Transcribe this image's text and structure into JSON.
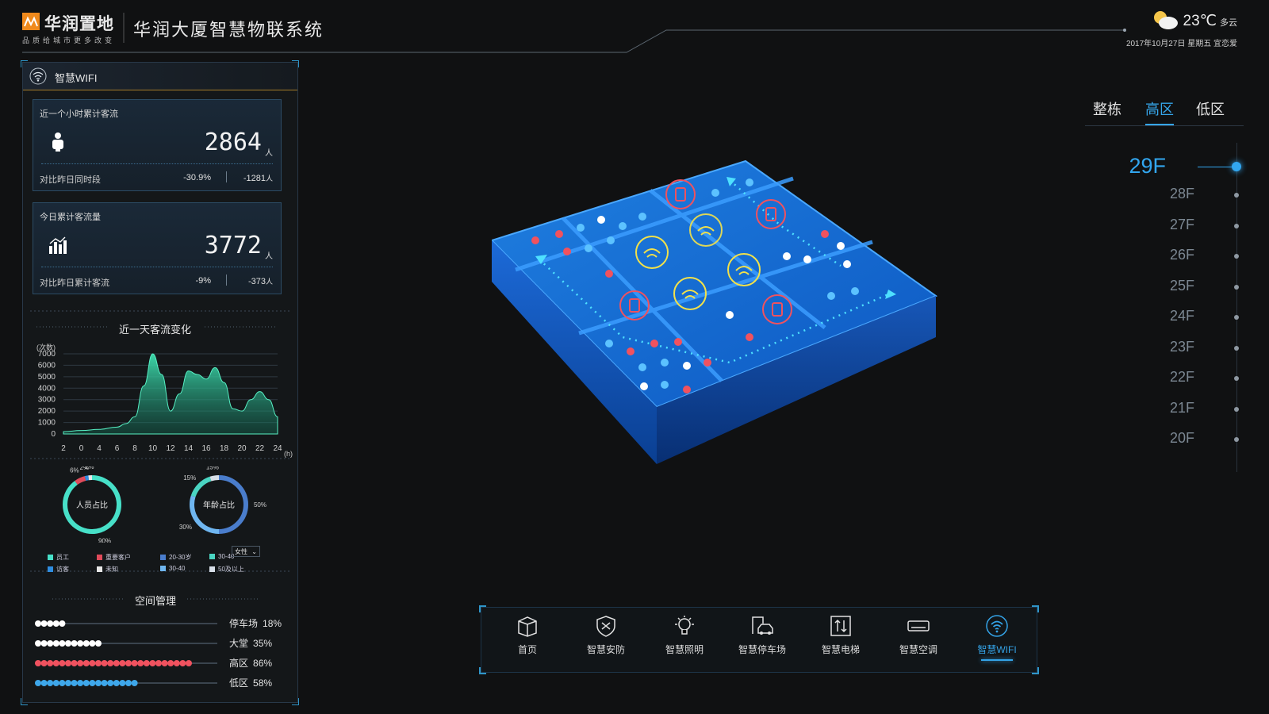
{
  "brand": {
    "name": "华润置地",
    "slogan": "品质给城市更多改变"
  },
  "system_title": "华润大厦智慧物联系统",
  "weather": {
    "temperature": "23℃",
    "condition": "多云",
    "date_line": "2017年10月27日 星期五 宜恋爱"
  },
  "panel": {
    "title": "智慧WIFI"
  },
  "card_hour": {
    "title": "近一个小时累计客流",
    "value": "2864",
    "unit": "人",
    "compare_label": "对比昨日同时段",
    "percent": "-30.9%",
    "delta": "-1281",
    "delta_unit": "人"
  },
  "card_day": {
    "title": "今日累计客流量",
    "value": "3772",
    "unit": "人",
    "compare_label": "对比昨日累计客流",
    "percent": "-9%",
    "delta": "-373",
    "delta_unit": "人"
  },
  "chart_data": {
    "type": "area",
    "title": "近一天客流变化",
    "ylabel": "(次数)",
    "xlabel": "(h)",
    "ylim": [
      0,
      7000
    ],
    "y_ticks": [
      "7000",
      "6000",
      "5000",
      "4000",
      "3000",
      "2000",
      "1000",
      "0"
    ],
    "x_ticks": [
      "2",
      "0",
      "4",
      "6",
      "8",
      "10",
      "12",
      "14",
      "16",
      "18",
      "20",
      "22",
      "24"
    ],
    "x": [
      0,
      2,
      4,
      6,
      7,
      8,
      9,
      10,
      11,
      12,
      13,
      14,
      15,
      16,
      17,
      18,
      19,
      20,
      21,
      22,
      23,
      24
    ],
    "values": [
      200,
      300,
      400,
      600,
      900,
      1500,
      4200,
      7000,
      5200,
      2000,
      3500,
      5500,
      5200,
      4800,
      5800,
      4500,
      2200,
      2000,
      3000,
      3700,
      3000,
      1500
    ],
    "grid": true,
    "color": "#2fc59d"
  },
  "donut_people": {
    "label": "人员占比",
    "values": [
      90,
      6,
      2,
      2
    ],
    "colors": [
      "#47e0c8",
      "#e04a5a",
      "#2f8de0",
      "#e8e8e8"
    ],
    "annotations": [
      "90%",
      "6%",
      "2%",
      "2%"
    ]
  },
  "donut_age": {
    "label": "年龄占比",
    "values": [
      50,
      30,
      15,
      5
    ],
    "colors": [
      "#4a7dcc",
      "#6fb6f0",
      "#4ad5c2",
      "#d8dfe8"
    ],
    "annotations": [
      "50%",
      "30%",
      "15%",
      "15%"
    ]
  },
  "legend_people": [
    {
      "label": "员工",
      "color": "#47e0c8"
    },
    {
      "label": "重要客户",
      "color": "#e04a5a"
    },
    {
      "label": "访客",
      "color": "#2f8de0"
    },
    {
      "label": "未知",
      "color": "#e8e8e8"
    }
  ],
  "legend_age": [
    {
      "label": "20-30岁",
      "color": "#4a7dcc"
    },
    {
      "label": "30-40",
      "color": "#4ad5c2"
    },
    {
      "label": "30-40",
      "color": "#6fb6f0"
    },
    {
      "label": "50及以上",
      "color": "#d8dfe8"
    }
  ],
  "gender_select": "女性",
  "space": {
    "title": "空间管理",
    "rows": [
      {
        "label": "停车场",
        "percent": "18%",
        "value": 0.18,
        "color": "#ffffff"
      },
      {
        "label": "大堂",
        "percent": "35%",
        "value": 0.35,
        "color": "#ffffff"
      },
      {
        "label": "高区",
        "percent": "86%",
        "value": 0.86,
        "color": "#f0525f"
      },
      {
        "label": "低区",
        "percent": "58%",
        "value": 0.58,
        "color": "#3ea7ea"
      }
    ]
  },
  "zone_tabs": [
    "整栋",
    "高区",
    "低区"
  ],
  "active_zone": "高区",
  "floors": [
    "29F",
    "28F",
    "27F",
    "26F",
    "25F",
    "24F",
    "23F",
    "22F",
    "21F",
    "20F"
  ],
  "active_floor": "29F",
  "nav": [
    {
      "label": "首页",
      "icon": "home-cube-icon"
    },
    {
      "label": "智慧安防",
      "icon": "shield-icon"
    },
    {
      "label": "智慧照明",
      "icon": "bulb-icon"
    },
    {
      "label": "智慧停车场",
      "icon": "car-icon"
    },
    {
      "label": "智慧电梯",
      "icon": "elevator-icon"
    },
    {
      "label": "智慧空调",
      "icon": "aircon-icon"
    },
    {
      "label": "智慧WIFI",
      "icon": "wifi-icon"
    }
  ],
  "active_nav": "智慧WIFI",
  "accent_color": "#34a3e7"
}
